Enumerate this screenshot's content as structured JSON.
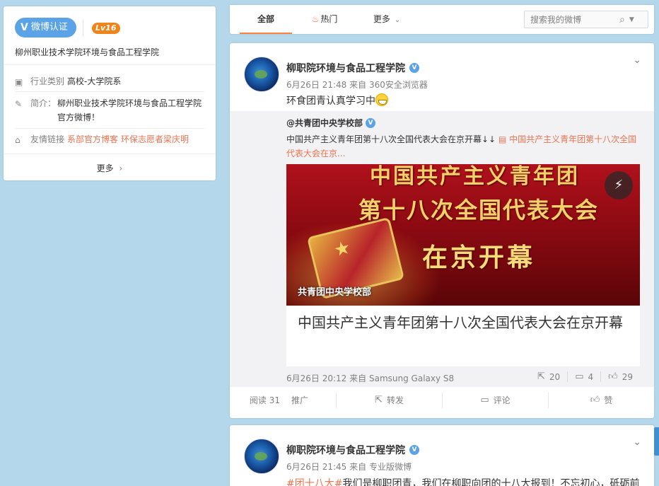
{
  "profile": {
    "verify_label": "微博认证",
    "verify_mark": "V",
    "level": "Lv16",
    "name": "柳州职业技术学院环境与食品工程学院",
    "industry_label": "行业类别",
    "industry_value": "高校-大学院系",
    "intro_label": "简介：",
    "intro_value": "柳州职业技术学院环境与食品工程学院官方微博！",
    "links_label": "友情链接",
    "link1": "系部官方博客",
    "link2": "环保志愿者梁庆明",
    "more": "更多"
  },
  "tabs": {
    "all": "全部",
    "hot": "热门",
    "more": "更多",
    "search_placeholder": "搜索我的微博"
  },
  "post1": {
    "author": "柳职院环境与食品工程学院",
    "time": "6月26日 21:48",
    "from_prefix": "来自",
    "source": "360安全浏览器",
    "text": "环食团青认真学习中",
    "repost": {
      "author": "@共青团中央学校部",
      "text": "中国共产主义青年团第十八次全国代表大会在京开幕↓↓",
      "link_text": "中国共产主义青年团第十八次全国代表大会在京...",
      "image_lines": [
        "中国共产主义青年团",
        "第十八次全国代表大会",
        "在京开幕"
      ],
      "image_caption": "共青团中央学校部",
      "card_title": "中国共产主义青年团第十八次全国代表大会在京开幕",
      "time": "6月26日 20:12",
      "from_prefix": "来自",
      "source": "Samsung Galaxy S8",
      "reposts": "20",
      "comments": "4",
      "likes": "29"
    },
    "footer": {
      "reads": "阅读 31",
      "promote": "推广",
      "forward": "转发",
      "comment": "评论",
      "like": "赞"
    }
  },
  "post2": {
    "author": "柳职院环境与食品工程学院",
    "time": "6月26日 21:45",
    "from_prefix": "来自",
    "source": "专业版微博",
    "hashtag": "#团十八大#",
    "text": "我们是柳职团青，我们在柳职向团的十八大报到！不忘初心，砥砺前"
  }
}
